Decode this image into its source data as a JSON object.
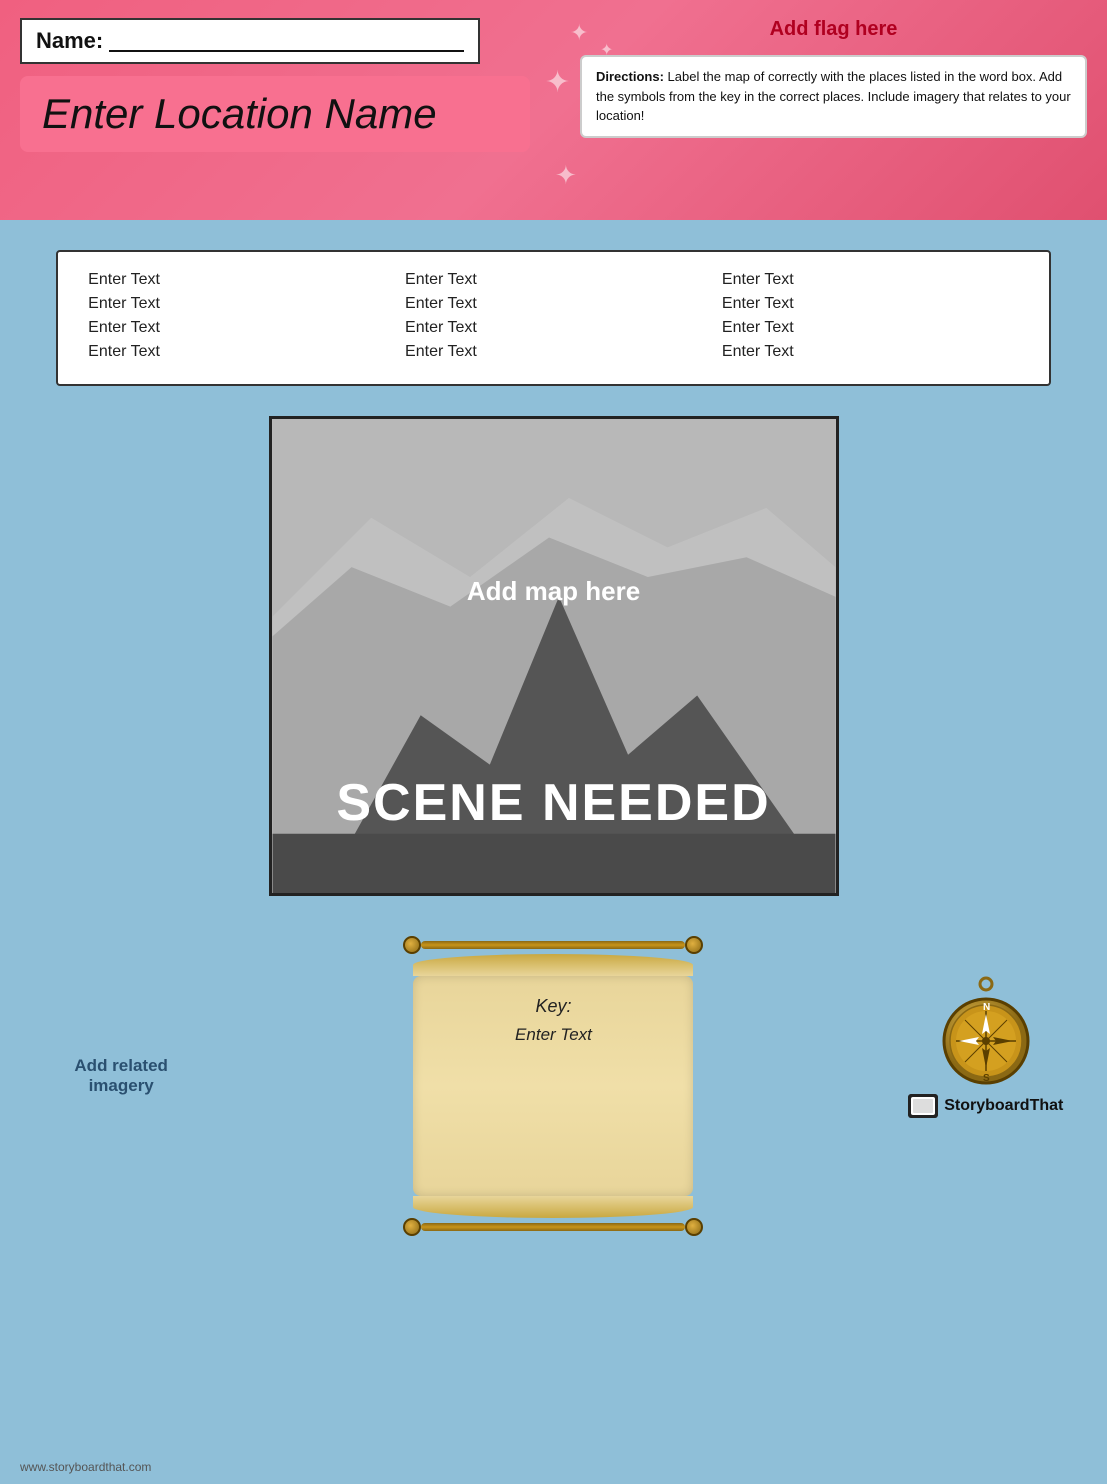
{
  "header": {
    "name_label": "Name:",
    "add_flag_label": "Add flag here",
    "location_title": "Enter Location Name",
    "directions_bold": "Directions:",
    "directions_text": " Label the map of  correctly with the places listed in the word box.  Add the symbols from the key in the correct places. Include imagery that relates to your location!"
  },
  "word_box": {
    "columns": [
      [
        "Enter Text",
        "Enter Text",
        "Enter Text",
        "Enter Text"
      ],
      [
        "Enter Text",
        "Enter Text",
        "Enter Text",
        "Enter Text"
      ],
      [
        "Enter Text",
        "Enter Text",
        "Enter Text",
        "Enter Text"
      ]
    ]
  },
  "map": {
    "add_map_label": "Add map here",
    "scene_needed_label": "SCENE NEEDED"
  },
  "scroll": {
    "key_label": "Key:",
    "enter_text_label": "Enter Text"
  },
  "sidebar": {
    "add_imagery_label": "Add related imagery"
  },
  "footer": {
    "website": "www.storyboardthat.com",
    "brand_name": "StoryboardThat"
  }
}
